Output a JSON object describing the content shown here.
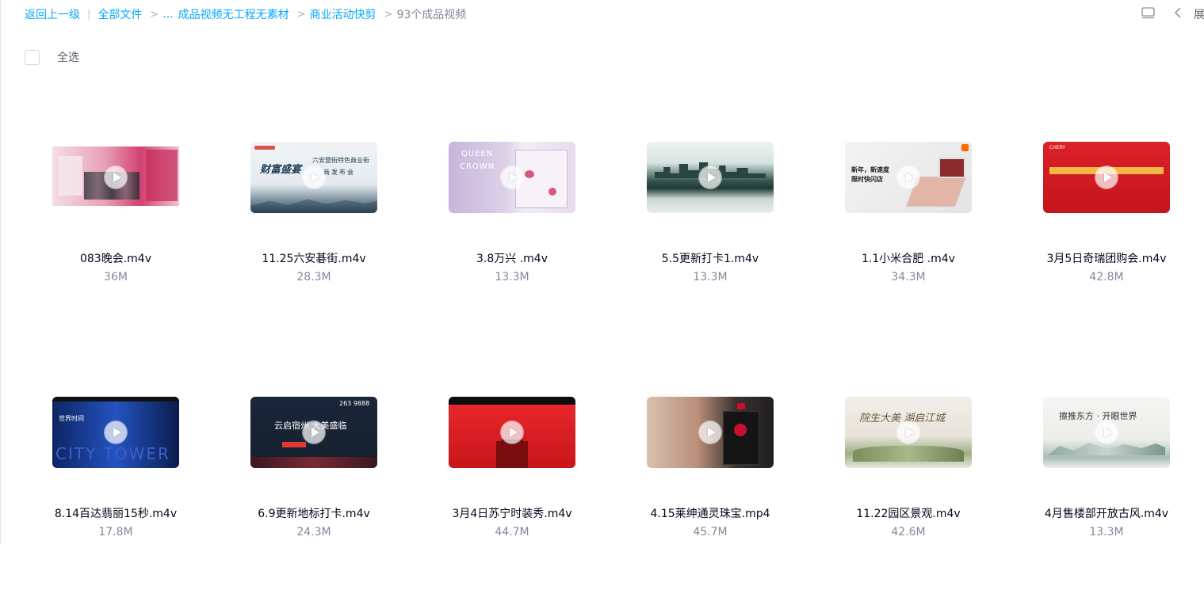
{
  "breadcrumb": {
    "back": "返回上一级",
    "all_files": "全部文件",
    "ellipsis": "...",
    "crumb_1": "成品视频无工程无素材",
    "crumb_2": "商业活动快剪",
    "current": "93个成品视频"
  },
  "toolbar": {
    "list_icon": "list-view-icon",
    "collapse_icon": "chevron-left-icon",
    "expand_label": "展"
  },
  "select_all": {
    "label": "全选"
  },
  "files": [
    {
      "name": "083晚会.m4v",
      "size": "36M",
      "thumb_colors": [
        "#f5dbe6",
        "#c93b66"
      ]
    },
    {
      "name": "11.25六安碁街.m4v",
      "size": "28.3M",
      "thumb_colors": [
        "#e8eef2",
        "#3e5a6a"
      ],
      "thumb_text": [
        "财富盛宴",
        "六安暨街特色商业街",
        "商发布会"
      ]
    },
    {
      "name": "3.8万兴 .m4v",
      "size": "13.3M",
      "thumb_colors": [
        "#cdbddc",
        "#ece3ee"
      ],
      "thumb_text": [
        "QUEEN",
        "CROWN"
      ]
    },
    {
      "name": "5.5更新打卡1.m4v",
      "size": "13.3M",
      "thumb_colors": [
        "#d8e6e3",
        "#1f4a44"
      ]
    },
    {
      "name": "1.1小米合肥 .m4v",
      "size": "34.3M",
      "thumb_colors": [
        "#ececec",
        "#d84c3a"
      ],
      "thumb_text": [
        "新年，新速度",
        "限时快闪店"
      ]
    },
    {
      "name": "3月5日奇瑞团购会.m4v",
      "size": "42.8M",
      "thumb_colors": [
        "#d71f26",
        "#b3121b"
      ],
      "thumb_text": [
        "CHERY"
      ]
    },
    {
      "name": "8.14百达翡丽15秒.m4v",
      "size": "17.8M",
      "thumb_colors": [
        "#1a3f9c",
        "#0c1f55"
      ],
      "thumb_text": [
        "世界时间",
        "CITY TOWER"
      ]
    },
    {
      "name": "6.9更新地标打卡.m4v",
      "size": "24.3M",
      "thumb_colors": [
        "#1d2a3e",
        "#0f1828"
      ],
      "thumb_text": [
        "263 9888",
        "云启宿州 大美盛临"
      ]
    },
    {
      "name": "3月4日苏宁时装秀.m4v",
      "size": "44.7M",
      "thumb_colors": [
        "#e01b1f",
        "#111111"
      ]
    },
    {
      "name": "4.15莱绅通灵珠宝.mp4",
      "size": "45.7M",
      "thumb_colors": [
        "#c9a995",
        "#2a2a2a"
      ]
    },
    {
      "name": "11.22园区景观.m4v",
      "size": "42.6M",
      "thumb_colors": [
        "#efece6",
        "#8b9a6d"
      ],
      "thumb_text": [
        "院生大美 湖启江城"
      ]
    },
    {
      "name": "4月售楼部开放古风.m4v",
      "size": "13.3M",
      "thumb_colors": [
        "#f3f3f1",
        "#8fa9a3"
      ],
      "thumb_text": [
        "擦推东方 · 开眼世界"
      ]
    }
  ]
}
